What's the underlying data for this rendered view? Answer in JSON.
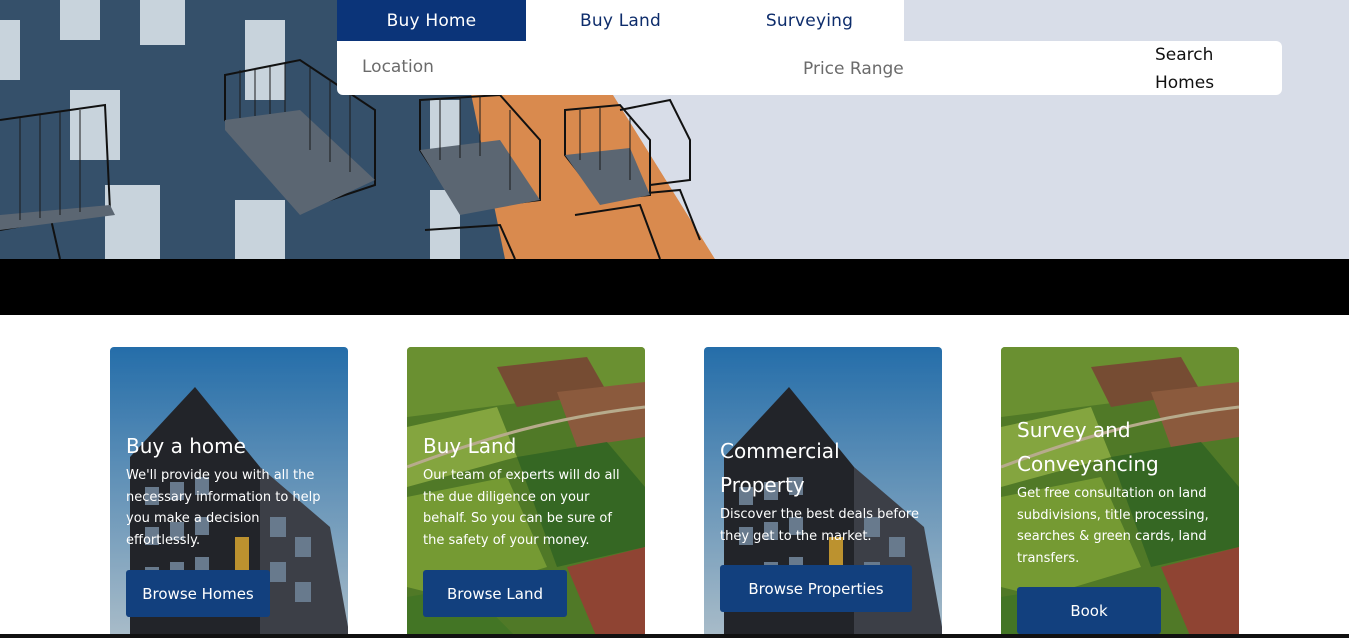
{
  "tabs": [
    {
      "label": "Buy Home",
      "active": true
    },
    {
      "label": "Buy Land",
      "active": false
    },
    {
      "label": "Surveying",
      "active": false
    }
  ],
  "search": {
    "location_placeholder": "Location",
    "price_placeholder": "Price Range",
    "button_label": "Search Homes"
  },
  "cards": [
    {
      "title": "Buy a home",
      "description": "We'll provide you with all the necessary information to help you make a decision effortlessly.",
      "button": "Browse Homes",
      "image": "apartment-building"
    },
    {
      "title": "Buy Land",
      "description": "Our team of experts will do all the due diligence on your behalf. So you can be sure of the safety of your money.",
      "button": "Browse Land",
      "image": "farmland-aerial"
    },
    {
      "title": "Commercial Property",
      "description": "Discover the best deals before they get to the market.",
      "button": "Browse Properties",
      "image": "apartment-building"
    },
    {
      "title": "Survey and Conveyancing",
      "description": "Get free consultation on land subdivisions, title processing, searches & green cards, land transfers.",
      "button": "Book",
      "image": "farmland-aerial"
    }
  ],
  "colors": {
    "primary": "#0b3479",
    "button": "#12407e",
    "hero_bg": "#d8dde8",
    "band": "#000000"
  }
}
